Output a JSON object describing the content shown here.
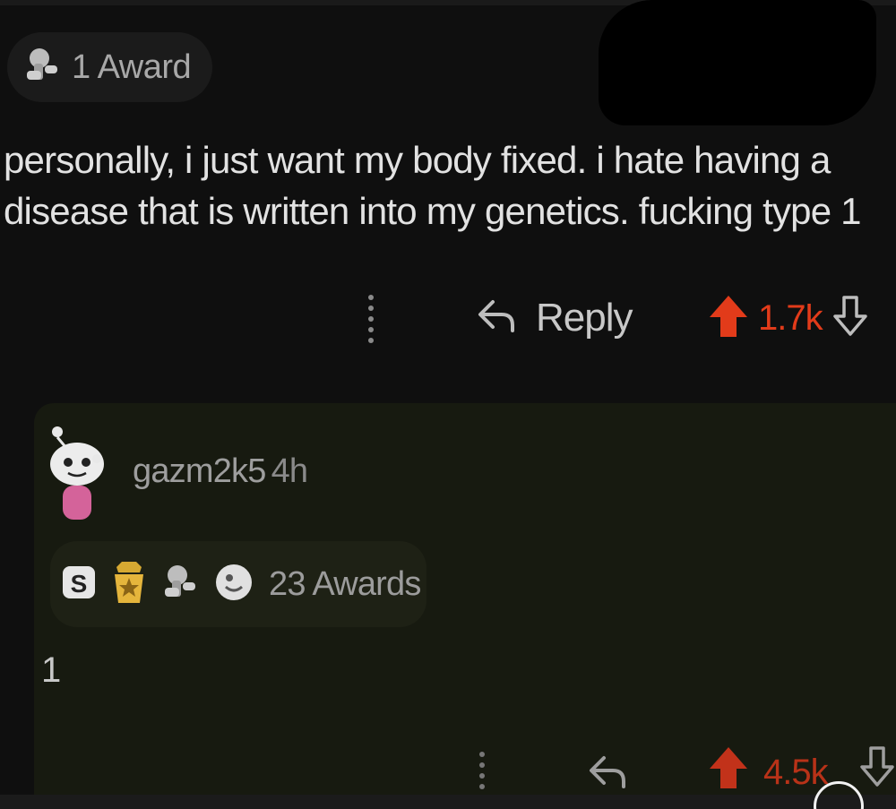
{
  "parent_comment": {
    "award_count_label": "1 Award",
    "body": "personally, i just want my body fixed. i hate having a disease that is written into my genetics. fucking type 1",
    "actions": {
      "more_icon": "more-vertical-icon",
      "reply_icon": "reply-arrow-icon",
      "reply_label": "Reply",
      "upvote_icon": "upvote-arrow-icon",
      "score": "1.7k",
      "downvote_icon": "downvote-arrow-icon"
    }
  },
  "reply_comment": {
    "username": "gazm2k5",
    "age": "4h",
    "award_icons": [
      "silver-award-icon",
      "gold-award-icon",
      "wholesome-award-icon",
      "helpful-award-icon"
    ],
    "awards_label": "23 Awards",
    "body": "1",
    "actions": {
      "score": "4.5k"
    }
  },
  "colors": {
    "background": "#0f0f0f",
    "reply_background": "#171a10",
    "upvote_active": "#e23b1a",
    "text": "#e2e2e2",
    "muted_text": "#9e9e9e"
  }
}
